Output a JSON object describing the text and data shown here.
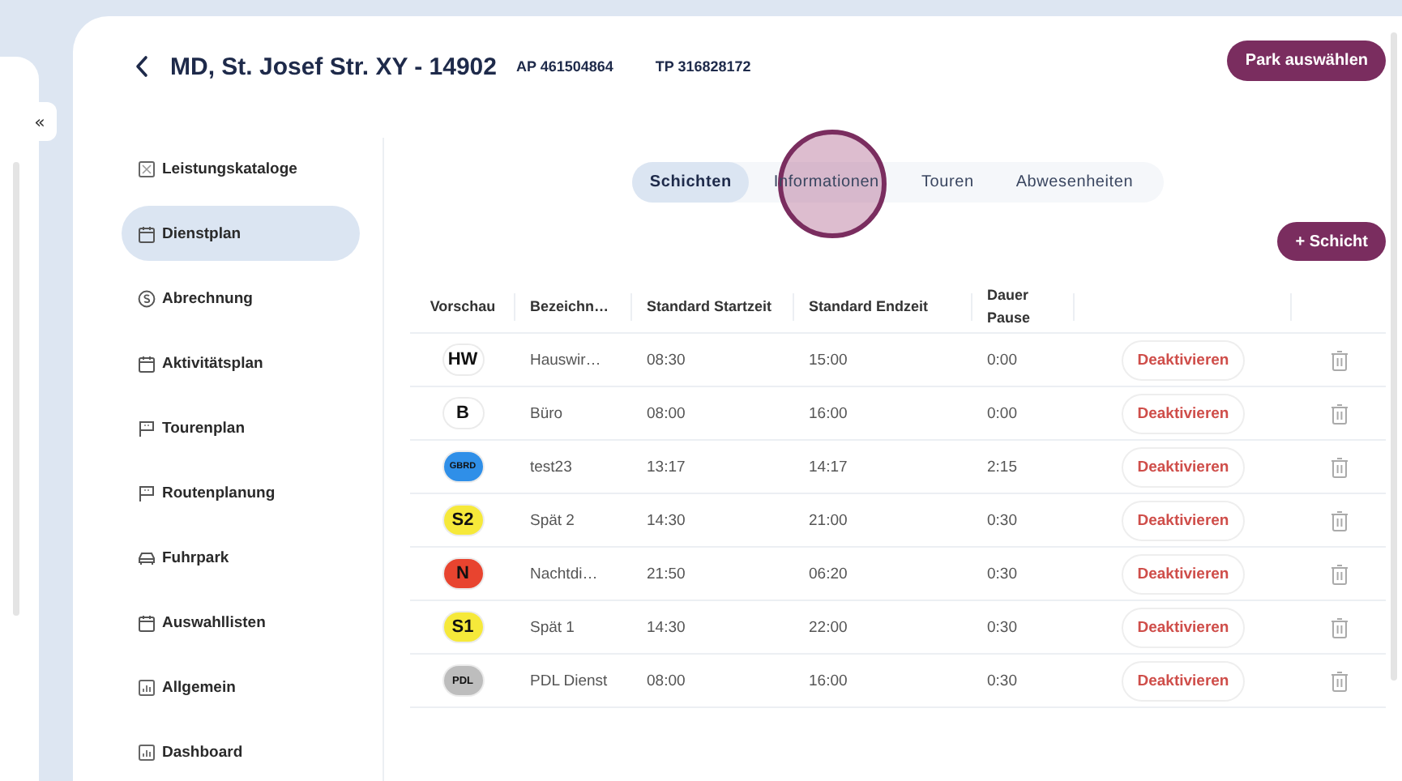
{
  "collapse_button": "«",
  "header": {
    "title": "MD, St. Josef Str. XY - 14902",
    "ap": "AP 461504864",
    "tp": "TP 316828172",
    "action": "Park auswählen"
  },
  "sidebar": {
    "items": [
      {
        "label": "Leistungskataloge",
        "selected": false
      },
      {
        "label": "Dienstplan",
        "selected": true
      },
      {
        "label": "Abrechnung",
        "selected": false
      },
      {
        "label": "Aktivitätsplan",
        "selected": false
      },
      {
        "label": "Tourenplan",
        "selected": false
      },
      {
        "label": "Routenplanung",
        "selected": false
      },
      {
        "label": "Fuhrpark",
        "selected": false
      },
      {
        "label": "Auswahllisten",
        "selected": false
      },
      {
        "label": "Allgemein",
        "selected": false
      },
      {
        "label": "Dashboard",
        "selected": false
      }
    ]
  },
  "tabs": [
    {
      "label": "Schichten",
      "selected": true
    },
    {
      "label": "Informationen",
      "selected": false
    },
    {
      "label": "Touren",
      "selected": false
    },
    {
      "label": "Abwesenheiten",
      "selected": false
    }
  ],
  "add_button": "+ Schicht",
  "table": {
    "columns": [
      "Vorschau",
      "Bezeichn…",
      "Standard Startzeit",
      "Standard Endzeit",
      "Dauer Pause"
    ],
    "rows": [
      {
        "badge": "HW",
        "color": "#ffffff",
        "name": "Hauswir…",
        "start": "08:30",
        "end": "15:00",
        "pause": "0:00",
        "action": "Deaktivieren"
      },
      {
        "badge": "B",
        "color": "#ffffff",
        "name": "Büro",
        "start": "08:00",
        "end": "16:00",
        "pause": "0:00",
        "action": "Deaktivieren"
      },
      {
        "badge": "GBRD",
        "color": "#2f8fe8",
        "name": "test23",
        "start": "13:17",
        "end": "14:17",
        "pause": "2:15",
        "action": "Deaktivieren"
      },
      {
        "badge": "S2",
        "color": "#f6e93a",
        "name": "Spät 2",
        "start": "14:30",
        "end": "21:00",
        "pause": "0:30",
        "action": "Deaktivieren"
      },
      {
        "badge": "N",
        "color": "#e8442f",
        "name": "Nachtdi…",
        "start": "21:50",
        "end": "06:20",
        "pause": "0:30",
        "action": "Deaktivieren"
      },
      {
        "badge": "S1",
        "color": "#f6e93a",
        "name": "Spät 1",
        "start": "14:30",
        "end": "22:00",
        "pause": "0:30",
        "action": "Deaktivieren"
      },
      {
        "badge": "PDL",
        "color": "#bdbdbd",
        "name": "PDL Dienst",
        "start": "08:00",
        "end": "16:00",
        "pause": "0:30",
        "action": "Deaktivieren"
      }
    ]
  }
}
